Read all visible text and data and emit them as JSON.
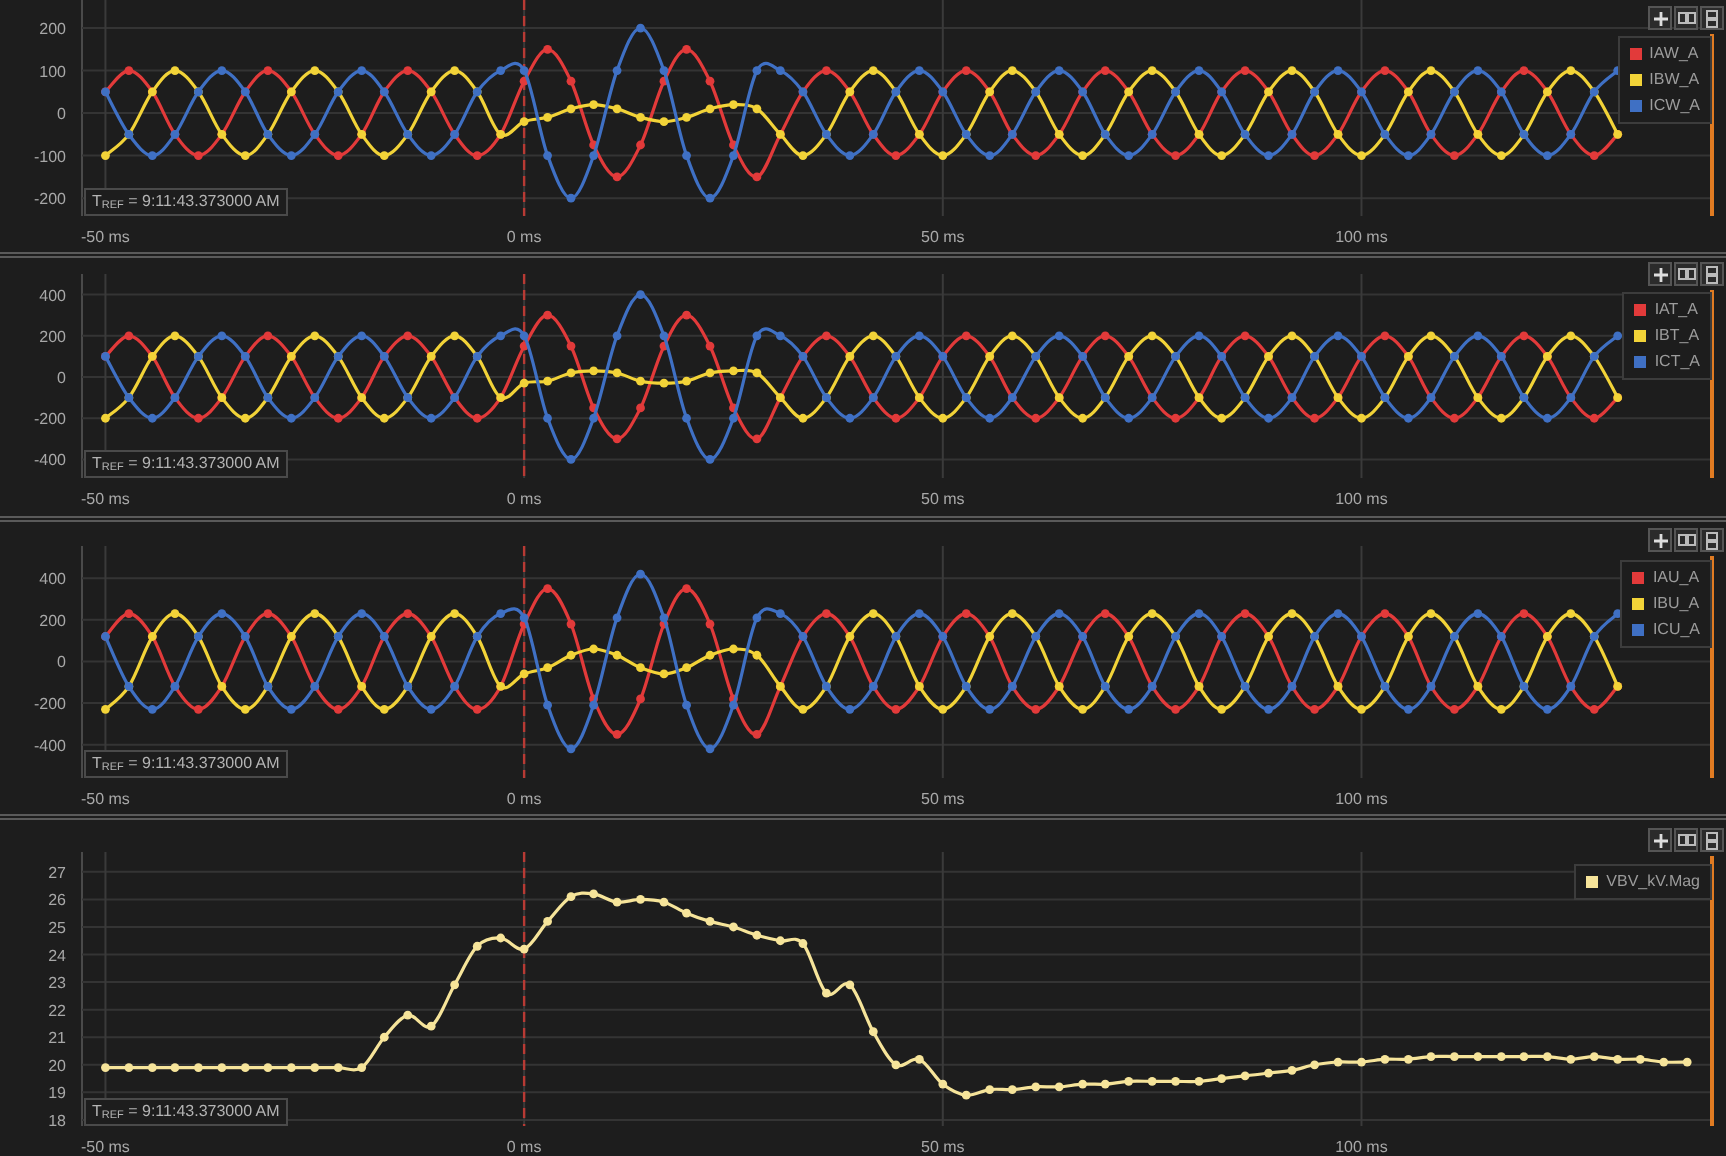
{
  "panels": [
    {
      "reference_time": "T$_{REF}$ = 9:11:43.373000 AM",
      "chart_data": {
        "type": "line",
        "grid": true,
        "xlim": [
          -52.8,
          142.1
        ],
        "ylim": [
          -242,
          266
        ],
        "ref_lines": [
          {
            "axis": "x",
            "value": 0,
            "color": "#b83a34"
          }
        ],
        "xticks": [
          {
            "value": -50,
            "label": "-50 ms"
          },
          {
            "value": 0,
            "label": "0 ms"
          },
          {
            "value": 50,
            "label": "50 ms"
          },
          {
            "value": 100,
            "label": "100 ms"
          }
        ],
        "yticks": [
          -200,
          -100,
          0,
          100,
          200
        ],
        "x": [
          -50,
          -47.2,
          -44.4,
          -41.7,
          -38.9,
          -36.1,
          -33.3,
          -30.6,
          -27.8,
          -25,
          -22.2,
          -19.4,
          -16.7,
          -13.9,
          -11.1,
          -8.3,
          -5.6,
          -2.8,
          0,
          2.8,
          5.6,
          8.3,
          11.1,
          13.9,
          16.7,
          19.4,
          22.2,
          25,
          27.8,
          30.6,
          33.3,
          36.1,
          38.9,
          41.7,
          44.4,
          47.2,
          50,
          52.8,
          55.6,
          58.3,
          61.1,
          63.9,
          66.7,
          69.4,
          72.2,
          75,
          77.8,
          80.6,
          83.3,
          86.1,
          88.9,
          91.7,
          94.4,
          97.2,
          100,
          102.8,
          105.6,
          108.3,
          111.1,
          113.9,
          116.7,
          119.4,
          122.2,
          125,
          127.8,
          130.6
        ],
        "series": [
          {
            "name": "IAW_A",
            "color": "#e23a3a",
            "marker": "circle",
            "values": [
              50,
              100,
              50,
              -50,
              -100,
              -50,
              50,
              100,
              50,
              -50,
              -100,
              -50,
              50,
              100,
              50,
              -50,
              -100,
              -50,
              75,
              150,
              75,
              -75,
              -150,
              -75,
              75,
              150,
              75,
              -75,
              -150,
              -50,
              50,
              100,
              50,
              -50,
              -100,
              -50,
              50,
              100,
              50,
              -50,
              -100,
              -50,
              50,
              100,
              50,
              -50,
              -100,
              -50,
              50,
              100,
              50,
              -50,
              -100,
              -50,
              50,
              100,
              50,
              -50,
              -100,
              -50,
              50,
              100,
              50,
              -50,
              -100,
              -50
            ]
          },
          {
            "name": "IBW_A",
            "color": "#f2d338",
            "marker": "circle",
            "values": [
              -100,
              -50,
              50,
              100,
              50,
              -50,
              -100,
              -50,
              50,
              100,
              50,
              -50,
              -100,
              -50,
              50,
              100,
              50,
              -50,
              -20,
              -10,
              10,
              20,
              10,
              -10,
              -20,
              -10,
              10,
              20,
              10,
              -50,
              -100,
              -50,
              50,
              100,
              50,
              -50,
              -100,
              -50,
              50,
              100,
              50,
              -50,
              -100,
              -50,
              50,
              100,
              50,
              -50,
              -100,
              -50,
              50,
              100,
              50,
              -50,
              -100,
              -50,
              50,
              100,
              50,
              -50,
              -100,
              -50,
              50,
              100,
              50,
              -50
            ]
          },
          {
            "name": "ICW_A",
            "color": "#3f70c4",
            "marker": "circle",
            "values": [
              50,
              -50,
              -100,
              -50,
              50,
              100,
              50,
              -50,
              -100,
              -50,
              50,
              100,
              50,
              -50,
              -100,
              -50,
              50,
              100,
              100,
              -100,
              -200,
              -100,
              100,
              200,
              100,
              -100,
              -200,
              -100,
              100,
              100,
              50,
              -50,
              -100,
              -50,
              50,
              100,
              50,
              -50,
              -100,
              -50,
              50,
              100,
              50,
              -50,
              -100,
              -50,
              50,
              100,
              50,
              -50,
              -100,
              -50,
              50,
              100,
              50,
              -50,
              -100,
              -50,
              50,
              100,
              50,
              -50,
              -100,
              -50,
              50,
              100
            ]
          }
        ]
      }
    },
    {
      "reference_time": "T$_{REF}$ = 9:11:43.373000 AM",
      "chart_data": {
        "type": "line",
        "grid": true,
        "xlim": [
          -52.8,
          142.1
        ],
        "ylim": [
          -490,
          500
        ],
        "ref_lines": [
          {
            "axis": "x",
            "value": 0,
            "color": "#b83a34"
          }
        ],
        "xticks": [
          {
            "value": -50,
            "label": "-50 ms"
          },
          {
            "value": 0,
            "label": "0 ms"
          },
          {
            "value": 50,
            "label": "50 ms"
          },
          {
            "value": 100,
            "label": "100 ms"
          }
        ],
        "yticks": [
          -400,
          -200,
          0,
          200,
          400
        ],
        "x": [
          -50,
          -47.2,
          -44.4,
          -41.7,
          -38.9,
          -36.1,
          -33.3,
          -30.6,
          -27.8,
          -25,
          -22.2,
          -19.4,
          -16.7,
          -13.9,
          -11.1,
          -8.3,
          -5.6,
          -2.8,
          0,
          2.8,
          5.6,
          8.3,
          11.1,
          13.9,
          16.7,
          19.4,
          22.2,
          25,
          27.8,
          30.6,
          33.3,
          36.1,
          38.9,
          41.7,
          44.4,
          47.2,
          50,
          52.8,
          55.6,
          58.3,
          61.1,
          63.9,
          66.7,
          69.4,
          72.2,
          75,
          77.8,
          80.6,
          83.3,
          86.1,
          88.9,
          91.7,
          94.4,
          97.2,
          100,
          102.8,
          105.6,
          108.3,
          111.1,
          113.9,
          116.7,
          119.4,
          122.2,
          125,
          127.8,
          130.6
        ],
        "series": [
          {
            "name": "IAT_A",
            "color": "#e23a3a",
            "marker": "circle",
            "values": [
              100,
              200,
              100,
              -100,
              -200,
              -100,
              100,
              200,
              100,
              -100,
              -200,
              -100,
              100,
              200,
              100,
              -100,
              -200,
              -100,
              150,
              300,
              150,
              -150,
              -300,
              -150,
              150,
              300,
              150,
              -150,
              -300,
              -100,
              100,
              200,
              100,
              -100,
              -200,
              -100,
              100,
              200,
              100,
              -100,
              -200,
              -100,
              100,
              200,
              100,
              -100,
              -200,
              -100,
              100,
              200,
              100,
              -100,
              -200,
              -100,
              100,
              200,
              100,
              -100,
              -200,
              -100,
              100,
              200,
              100,
              -100,
              -200,
              -100
            ]
          },
          {
            "name": "IBT_A",
            "color": "#f2d338",
            "marker": "circle",
            "values": [
              -200,
              -100,
              100,
              200,
              100,
              -100,
              -200,
              -100,
              100,
              200,
              100,
              -100,
              -200,
              -100,
              100,
              200,
              100,
              -100,
              -30,
              -20,
              20,
              30,
              20,
              -20,
              -30,
              -20,
              20,
              30,
              20,
              -100,
              -200,
              -100,
              100,
              200,
              100,
              -100,
              -200,
              -100,
              100,
              200,
              100,
              -100,
              -200,
              -100,
              100,
              200,
              100,
              -100,
              -200,
              -100,
              100,
              200,
              100,
              -100,
              -200,
              -100,
              100,
              200,
              100,
              -100,
              -200,
              -100,
              100,
              200,
              100,
              -100
            ]
          },
          {
            "name": "ICT_A",
            "color": "#3f70c4",
            "marker": "circle",
            "values": [
              100,
              -100,
              -200,
              -100,
              100,
              200,
              100,
              -100,
              -200,
              -100,
              100,
              200,
              100,
              -100,
              -200,
              -100,
              100,
              200,
              200,
              -200,
              -400,
              -200,
              200,
              400,
              200,
              -200,
              -400,
              -200,
              200,
              200,
              100,
              -100,
              -200,
              -100,
              100,
              200,
              100,
              -100,
              -200,
              -100,
              100,
              200,
              100,
              -100,
              -200,
              -100,
              100,
              200,
              100,
              -100,
              -200,
              -100,
              100,
              200,
              100,
              -100,
              -200,
              -100,
              100,
              200,
              100,
              -100,
              -200,
              -100,
              100,
              200
            ]
          }
        ]
      }
    },
    {
      "reference_time": "T$_{REF}$ = 9:11:43.373000 AM",
      "chart_data": {
        "type": "line",
        "grid": true,
        "xlim": [
          -52.8,
          142.1
        ],
        "ylim": [
          -560,
          555
        ],
        "ref_lines": [
          {
            "axis": "x",
            "value": 0,
            "color": "#b83a34"
          }
        ],
        "xticks": [
          {
            "value": -50,
            "label": "-50 ms"
          },
          {
            "value": 0,
            "label": "0 ms"
          },
          {
            "value": 50,
            "label": "50 ms"
          },
          {
            "value": 100,
            "label": "100 ms"
          }
        ],
        "yticks": [
          -400,
          -200,
          0,
          200,
          400
        ],
        "x": [
          -50,
          -47.2,
          -44.4,
          -41.7,
          -38.9,
          -36.1,
          -33.3,
          -30.6,
          -27.8,
          -25,
          -22.2,
          -19.4,
          -16.7,
          -13.9,
          -11.1,
          -8.3,
          -5.6,
          -2.8,
          0,
          2.8,
          5.6,
          8.3,
          11.1,
          13.9,
          16.7,
          19.4,
          22.2,
          25,
          27.8,
          30.6,
          33.3,
          36.1,
          38.9,
          41.7,
          44.4,
          47.2,
          50,
          52.8,
          55.6,
          58.3,
          61.1,
          63.9,
          66.7,
          69.4,
          72.2,
          75,
          77.8,
          80.6,
          83.3,
          86.1,
          88.9,
          91.7,
          94.4,
          97.2,
          100,
          102.8,
          105.6,
          108.3,
          111.1,
          113.9,
          116.7,
          119.4,
          122.2,
          125,
          127.8,
          130.6
        ],
        "series": [
          {
            "name": "IAU_A",
            "color": "#e23a3a",
            "marker": "circle",
            "values": [
              120,
              230,
              120,
              -120,
              -230,
              -120,
              120,
              230,
              120,
              -120,
              -230,
              -120,
              120,
              230,
              120,
              -120,
              -230,
              -120,
              180,
              350,
              180,
              -180,
              -350,
              -180,
              180,
              350,
              180,
              -180,
              -350,
              -120,
              120,
              230,
              120,
              -120,
              -230,
              -120,
              120,
              230,
              120,
              -120,
              -230,
              -120,
              120,
              230,
              120,
              -120,
              -230,
              -120,
              120,
              230,
              120,
              -120,
              -230,
              -120,
              120,
              230,
              120,
              -120,
              -230,
              -120,
              120,
              230,
              120,
              -120,
              -230,
              -120
            ]
          },
          {
            "name": "IBU_A",
            "color": "#f2d338",
            "marker": "circle",
            "values": [
              -230,
              -120,
              120,
              230,
              120,
              -120,
              -230,
              -120,
              120,
              230,
              120,
              -120,
              -230,
              -120,
              120,
              230,
              120,
              -120,
              -60,
              -30,
              30,
              60,
              30,
              -30,
              -60,
              -30,
              30,
              60,
              30,
              -120,
              -230,
              -120,
              120,
              230,
              120,
              -120,
              -230,
              -120,
              120,
              230,
              120,
              -120,
              -230,
              -120,
              120,
              230,
              120,
              -120,
              -230,
              -120,
              120,
              230,
              120,
              -120,
              -230,
              -120,
              120,
              230,
              120,
              -120,
              -230,
              -120,
              120,
              230,
              120,
              -120
            ]
          },
          {
            "name": "ICU_A",
            "color": "#3f70c4",
            "marker": "circle",
            "values": [
              120,
              -120,
              -230,
              -120,
              120,
              230,
              120,
              -120,
              -230,
              -120,
              120,
              230,
              120,
              -120,
              -230,
              -120,
              120,
              230,
              210,
              -210,
              -420,
              -210,
              210,
              420,
              210,
              -210,
              -420,
              -210,
              210,
              230,
              120,
              -120,
              -230,
              -120,
              120,
              230,
              120,
              -120,
              -230,
              -120,
              120,
              230,
              120,
              -120,
              -230,
              -120,
              120,
              230,
              120,
              -120,
              -230,
              -120,
              120,
              230,
              120,
              -120,
              -230,
              -120,
              120,
              230,
              120,
              -120,
              -230,
              -120,
              120,
              230
            ]
          }
        ]
      }
    },
    {
      "reference_time": "T$_{REF}$ = 9:11:43.373000 AM",
      "chart_data": {
        "type": "line",
        "grid": true,
        "xlim": [
          -52.8,
          142.1
        ],
        "ylim": [
          17.78,
          27.72
        ],
        "ref_lines": [
          {
            "axis": "x",
            "value": 0,
            "color": "#b83a34"
          }
        ],
        "xticks": [
          {
            "value": -50,
            "label": "-50 ms"
          },
          {
            "value": 0,
            "label": "0 ms"
          },
          {
            "value": 50,
            "label": "50 ms"
          },
          {
            "value": 100,
            "label": "100 ms"
          }
        ],
        "yticks": [
          18,
          19,
          20,
          21,
          22,
          23,
          24,
          25,
          26,
          27
        ],
        "x": [
          -50,
          -47.2,
          -44.4,
          -41.7,
          -38.9,
          -36.1,
          -33.3,
          -30.6,
          -27.8,
          -25,
          -22.2,
          -19.4,
          -16.7,
          -13.9,
          -11.1,
          -8.3,
          -5.6,
          -2.8,
          0,
          2.8,
          5.6,
          8.3,
          11.1,
          13.9,
          16.7,
          19.4,
          22.2,
          25,
          27.8,
          30.6,
          33.3,
          36.1,
          38.9,
          41.7,
          44.4,
          47.2,
          50,
          52.8,
          55.6,
          58.3,
          61.1,
          63.9,
          66.7,
          69.4,
          72.2,
          75,
          77.8,
          80.6,
          83.3,
          86.1,
          88.9,
          91.7,
          94.4,
          97.2,
          100,
          102.8,
          105.6,
          108.3,
          111.1,
          113.9,
          116.7,
          119.4,
          122.2,
          125,
          127.8,
          130.6,
          133.3,
          136.1,
          138.9
        ],
        "series": [
          {
            "name": "VBV_kV.Mag",
            "color": "#f6e49a",
            "marker": "circle",
            "values": [
              19.9,
              19.9,
              19.9,
              19.9,
              19.9,
              19.9,
              19.9,
              19.9,
              19.9,
              19.9,
              19.9,
              19.9,
              21.0,
              21.8,
              21.4,
              22.9,
              24.3,
              24.6,
              24.2,
              25.2,
              26.1,
              26.2,
              25.9,
              26.0,
              25.9,
              25.5,
              25.2,
              25.0,
              24.7,
              24.5,
              24.4,
              22.6,
              22.9,
              21.2,
              20.0,
              20.2,
              19.3,
              18.9,
              19.1,
              19.1,
              19.2,
              19.2,
              19.3,
              19.3,
              19.4,
              19.4,
              19.4,
              19.4,
              19.5,
              19.6,
              19.7,
              19.8,
              20.0,
              20.1,
              20.1,
              20.2,
              20.2,
              20.3,
              20.3,
              20.3,
              20.3,
              20.3,
              20.3,
              20.2,
              20.3,
              20.2,
              20.2,
              20.1,
              20.1
            ]
          }
        ]
      }
    }
  ]
}
